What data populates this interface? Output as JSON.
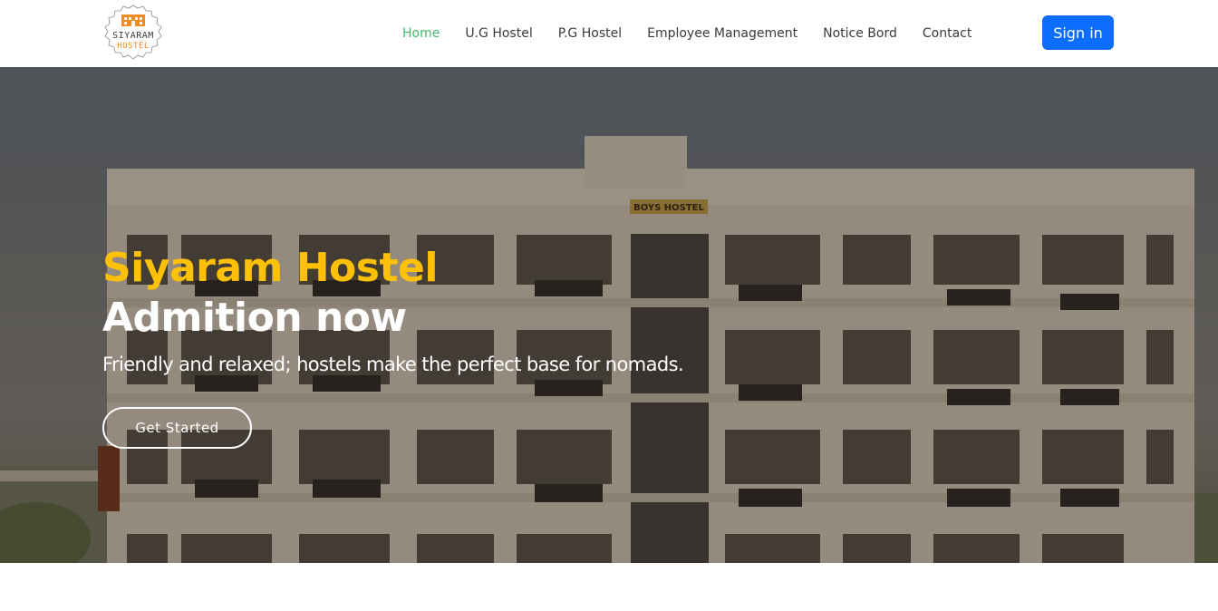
{
  "brand": {
    "logo_line1": "SIYARAM",
    "logo_line2": "HOSTEL",
    "logo_color_primary": "#3a3a3a",
    "logo_color_accent": "#f08a24"
  },
  "nav": {
    "items": [
      {
        "label": "Home",
        "active": true
      },
      {
        "label": "U.G Hostel",
        "active": false
      },
      {
        "label": "P.G Hostel",
        "active": false
      },
      {
        "label": "Employee Management",
        "active": false
      },
      {
        "label": "Notice Bord",
        "active": false
      },
      {
        "label": "Contact",
        "active": false
      }
    ],
    "signin_label": "Sign in",
    "active_color": "#47b96b",
    "signin_color": "#0d6efd"
  },
  "hero": {
    "title_line1": "Siyaram Hostel",
    "title_line2": "Admition now",
    "subtitle": "Friendly and relaxed; hostels make the perfect base for nomads.",
    "cta_label": "Get Started",
    "building_sign": "BOYS HOSTEL",
    "accent_color": "#ffc107"
  }
}
